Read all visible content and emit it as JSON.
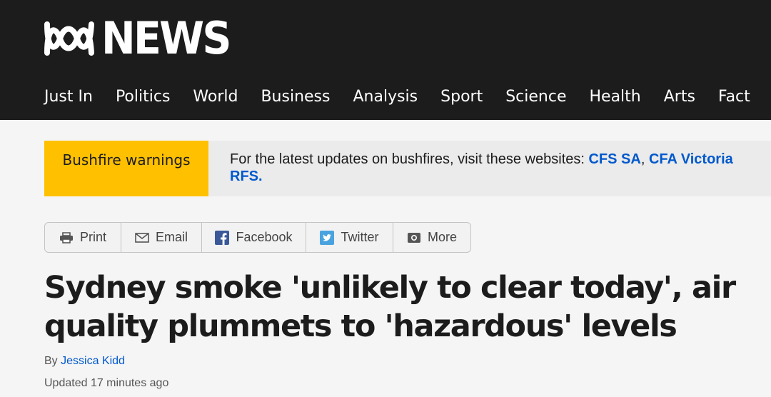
{
  "brand": {
    "name": "NEWS",
    "icon": "abc-lissajous-logo"
  },
  "nav": {
    "items": [
      "Just In",
      "Politics",
      "World",
      "Business",
      "Analysis",
      "Sport",
      "Science",
      "Health",
      "Arts",
      "Fact"
    ]
  },
  "alert": {
    "label": "Bushfire warnings",
    "text": "For the latest updates on bushfires, visit these websites: ",
    "links": [
      "CFS SA",
      "CFA Victoria",
      "RFS."
    ],
    "separator": ", ",
    "accent": "#ffc000",
    "link_color": "#0058cc"
  },
  "share": {
    "print": "Print",
    "email": "Email",
    "facebook": "Facebook",
    "twitter": "Twitter",
    "more": "More",
    "icons": [
      "printer-icon",
      "envelope-icon",
      "facebook-icon",
      "twitter-icon",
      "more-icon"
    ]
  },
  "article": {
    "headline": "Sydney smoke 'unlikely to clear today', air quality plummets to 'hazardous' levels",
    "byline_prefix": "By ",
    "author": "Jessica Kidd",
    "updated": "Updated 17 minutes ago"
  },
  "colors": {
    "masthead": "#1c1c1c",
    "background": "#f5f5f5"
  }
}
